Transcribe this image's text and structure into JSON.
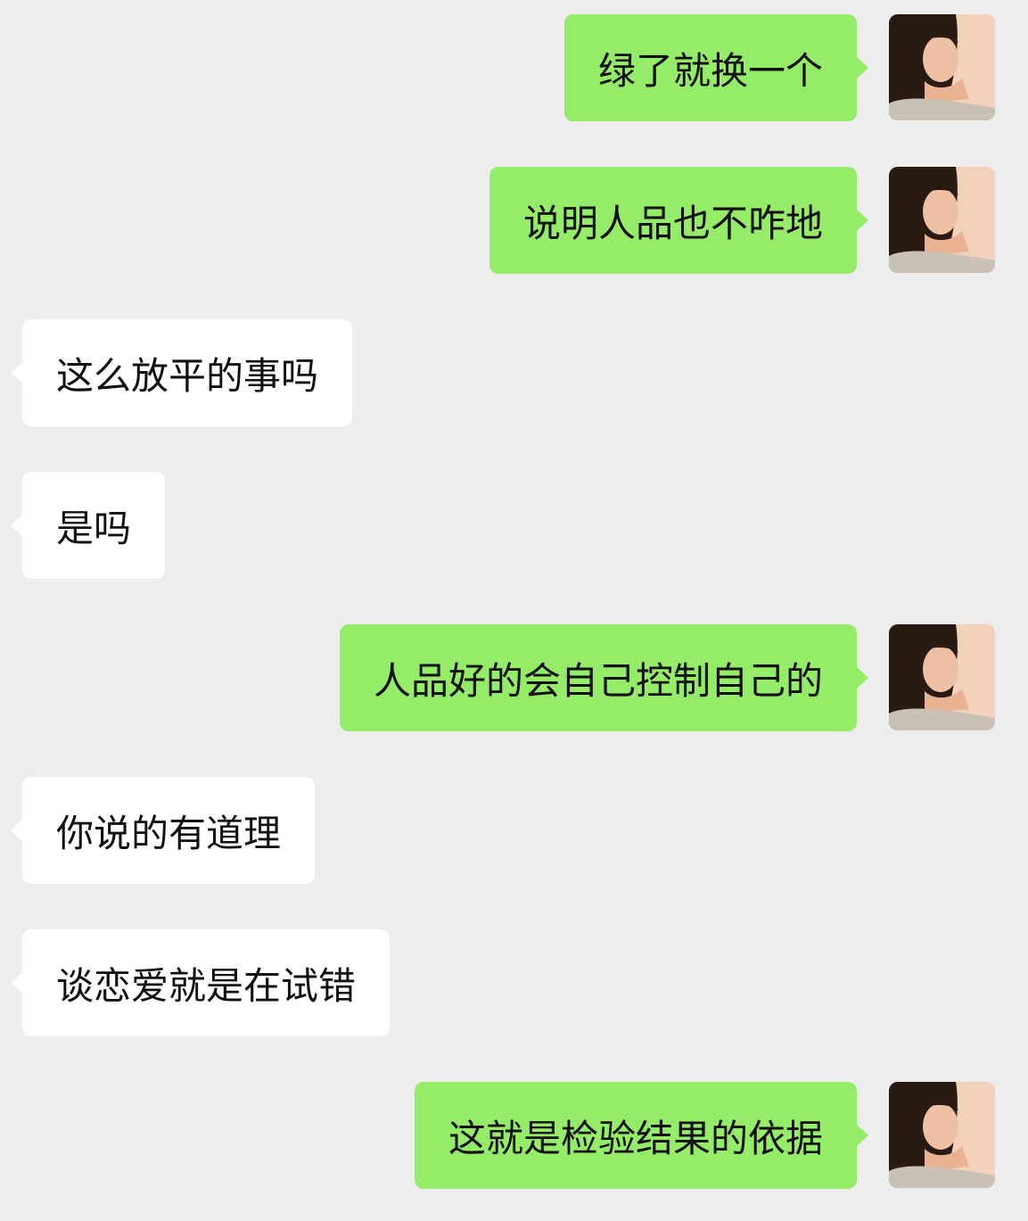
{
  "messages": [
    {
      "side": "right",
      "text": "绿了就换一个"
    },
    {
      "side": "right",
      "text": "说明人品也不咋地"
    },
    {
      "side": "left",
      "text": "这么放平的事吗"
    },
    {
      "side": "left",
      "text": "是吗"
    },
    {
      "side": "right",
      "text": "人品好的会自己控制自己的"
    },
    {
      "side": "left",
      "text": "你说的有道理"
    },
    {
      "side": "left",
      "text": "谈恋爱就是在试错"
    },
    {
      "side": "right",
      "text": "这就是检验结果的依据"
    }
  ],
  "colors": {
    "background": "#ededed",
    "sent_bubble": "#95ec69",
    "received_bubble": "#ffffff",
    "text": "#111111"
  }
}
